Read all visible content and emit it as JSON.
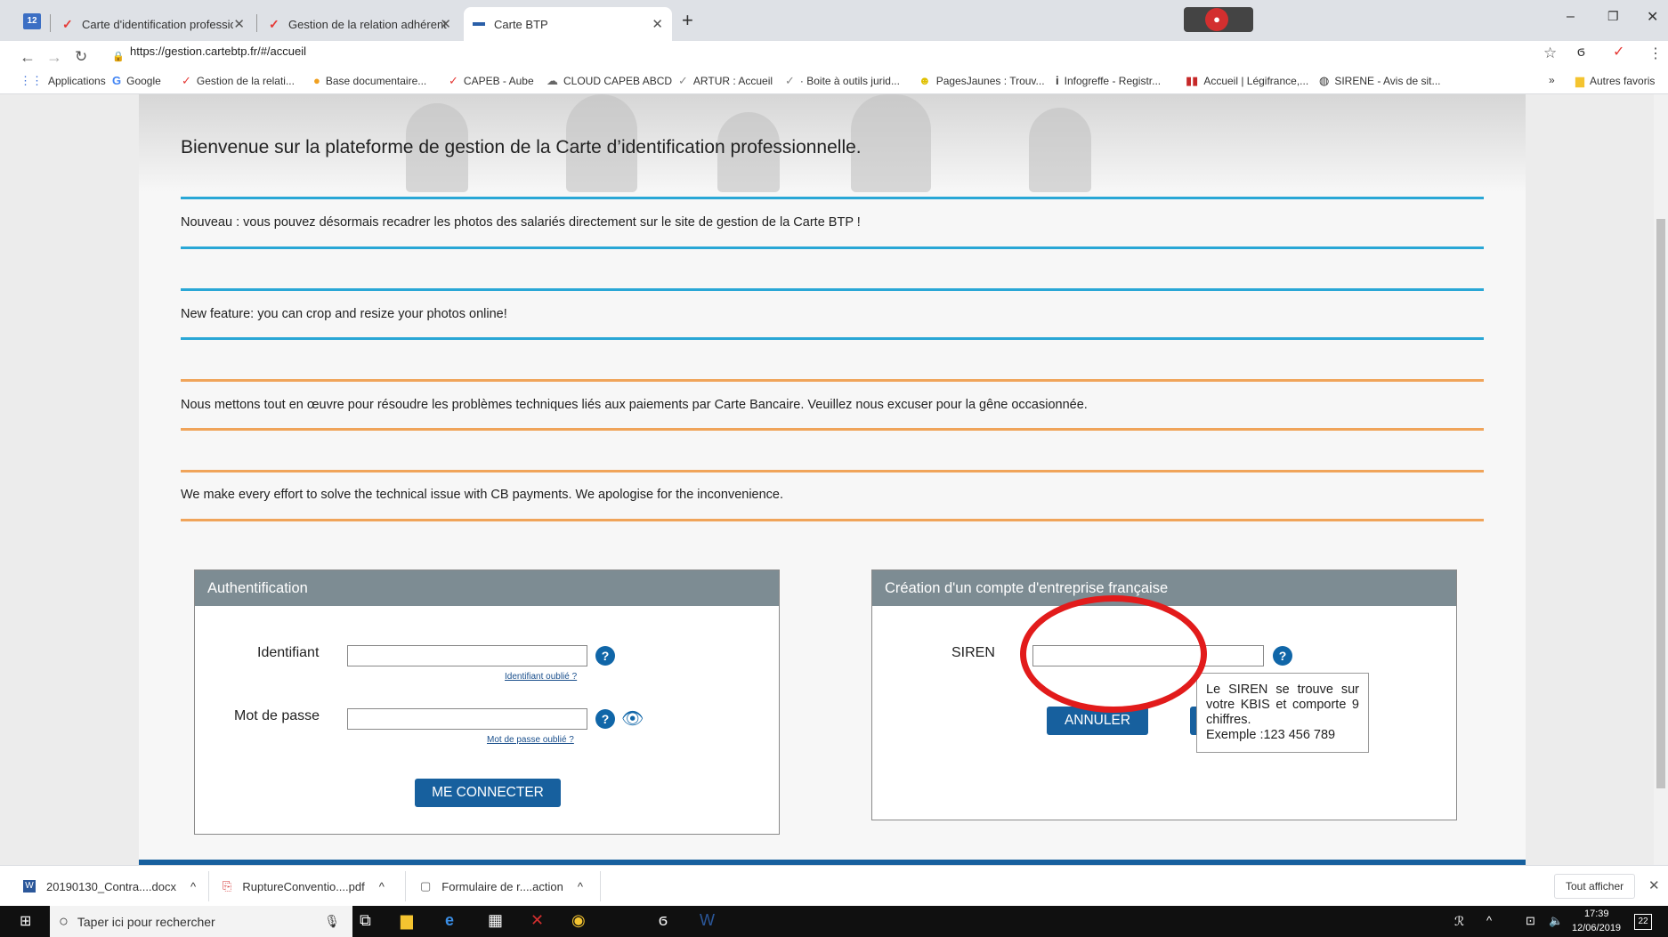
{
  "browser": {
    "tabs": [
      {
        "label": "Carte d'identification professionn"
      },
      {
        "label": "Gestion de la relation adhérent"
      },
      {
        "label": "Carte BTP"
      }
    ],
    "tab_counter": "12",
    "url": "https://gestion.cartebtp.fr/#/accueil",
    "bookmarks": [
      "Applications",
      "Google",
      "Gestion de la relati...",
      "Base documentaire...",
      "CAPEB - Aube",
      "CLOUD CAPEB ABCD",
      "ARTUR : Accueil",
      "· Boite à outils jurid...",
      "PagesJaunes : Trouv...",
      "Infogreffe - Registr...",
      "Accueil | Légifrance,...",
      "SIRENE - Avis de sit..."
    ],
    "other_bookmarks": "Autres favoris"
  },
  "page": {
    "welcome": "Bienvenue sur la plateforme de gestion de la Carte d’identification professionnelle.",
    "notices": [
      "Nouveau : vous pouvez désormais recadrer les photos des salariés directement sur le site de gestion de la Carte BTP !",
      "New feature: you can crop and resize your photos online!",
      "Nous mettons tout en œuvre pour résoudre les problèmes techniques liés aux paiements par Carte Bancaire. Veuillez nous excuser pour la gêne occasionnée.",
      "We make every effort to solve the technical issue with CB payments. We apologise for the inconvenience."
    ],
    "auth": {
      "title": "Authentification",
      "id_label": "Identifiant",
      "id_value": "",
      "id_forgot": "Identifiant oublié ?",
      "pw_label": "Mot de passe",
      "pw_value": "",
      "pw_forgot": "Mot de passe oublié ?",
      "submit": "ME CONNECTER"
    },
    "create": {
      "title": "Création d'un compte d'entreprise française",
      "siren_label": "SIREN",
      "siren_value": "",
      "cancel": "ANNULER",
      "tooltip_line1": "Le SIREN se trouve sur votre KBIS et comporte 9 chiffres.",
      "tooltip_line2": "Exemple :123 456 789"
    }
  },
  "downloads": {
    "items": [
      "20190130_Contra....docx",
      "RuptureConventio....pdf",
      "Formulaire de r....action"
    ],
    "show_all": "Tout afficher"
  },
  "taskbar": {
    "search_placeholder": "Taper ici pour rechercher",
    "time": "17:39",
    "date": "12/06/2019",
    "notif_count": "22"
  },
  "colors": {
    "accent_blue": "#17609e",
    "rule_blue": "#29a7d6",
    "rule_orange": "#f0a45a",
    "panel_header": "#7d8c93",
    "annotation_red": "#e21b1b"
  }
}
